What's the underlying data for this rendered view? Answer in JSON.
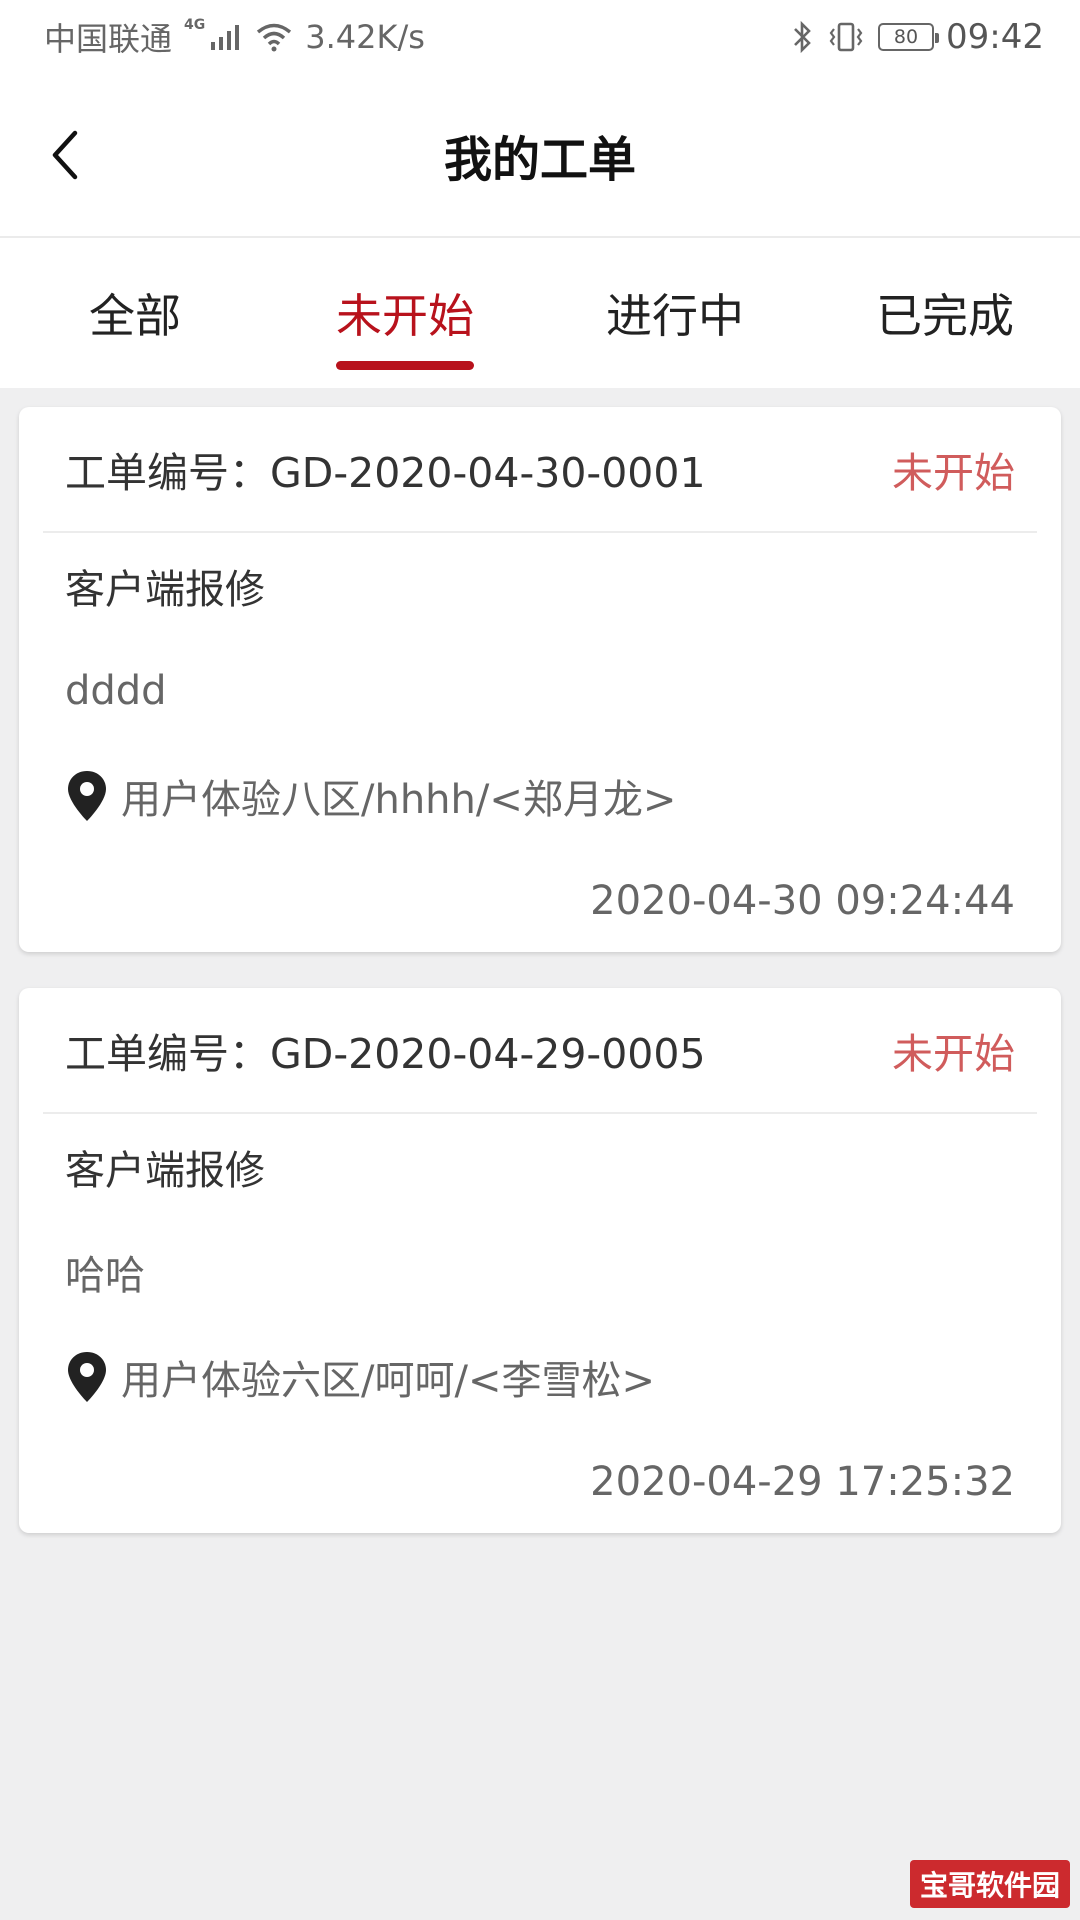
{
  "status_bar": {
    "carrier": "中国联通",
    "network": "4G",
    "speed": "3.42K/s",
    "battery": "80",
    "time": "09:42"
  },
  "header": {
    "title": "我的工单"
  },
  "tabs": [
    {
      "label": "全部",
      "active": false
    },
    {
      "label": "未开始",
      "active": true
    },
    {
      "label": "进行中",
      "active": false
    },
    {
      "label": "已完成",
      "active": false
    }
  ],
  "orders": [
    {
      "number": "工单编号：GD-2020-04-30-0001",
      "status": "未开始",
      "type": "客户端报修",
      "description": "dddd",
      "location": "用户体验八区/hhhh/<郑月龙>",
      "time": "2020-04-30 09:24:44"
    },
    {
      "number": "工单编号：GD-2020-04-29-0005",
      "status": "未开始",
      "type": "客户端报修",
      "description": "哈哈",
      "location": "用户体验六区/呵呵/<李雪松>",
      "time": "2020-04-29 17:25:32"
    }
  ],
  "watermark": "宝哥软件园",
  "colors": {
    "accent": "#b8121c",
    "status_text": "#d05c5c",
    "background": "#efeff0"
  }
}
